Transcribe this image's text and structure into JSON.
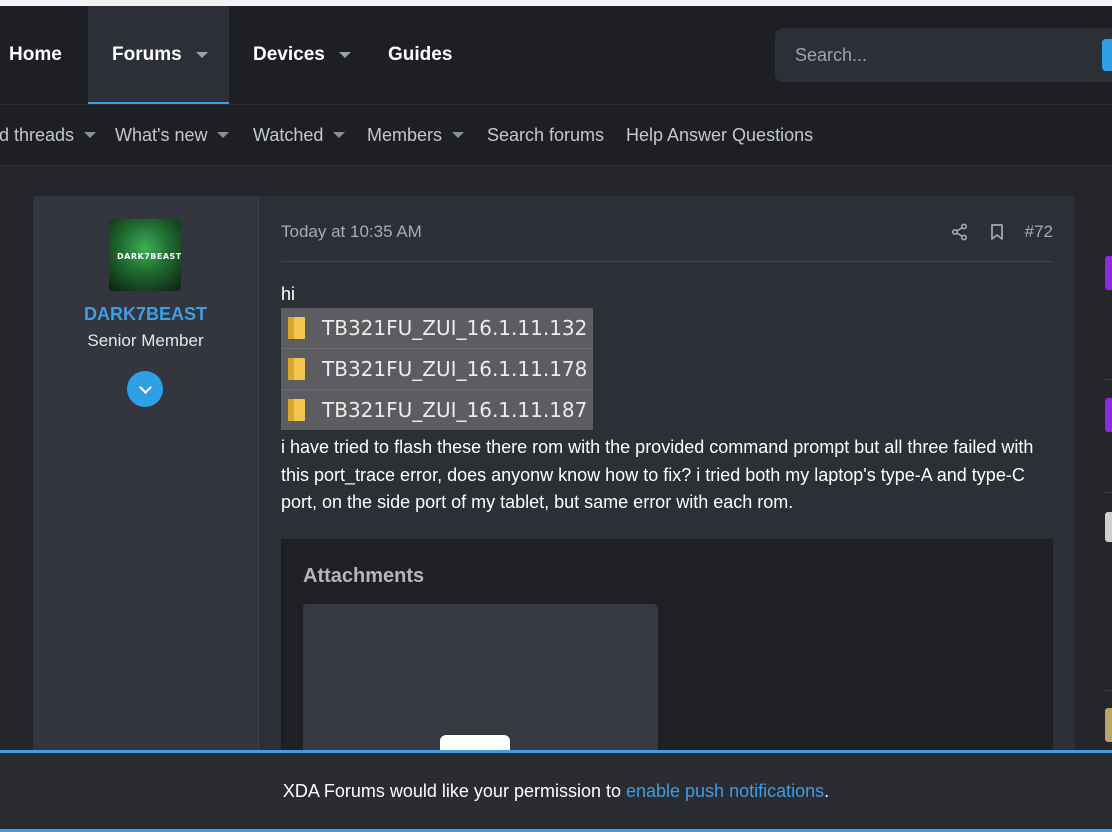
{
  "nav": {
    "tabs": [
      {
        "label": "Home",
        "has_menu": false
      },
      {
        "label": "Forums",
        "has_menu": true,
        "active": true
      },
      {
        "label": "Devices",
        "has_menu": true
      },
      {
        "label": "Guides",
        "has_menu": false
      }
    ],
    "search_placeholder": "Search..."
  },
  "subnav": {
    "items": [
      {
        "label": "d threads",
        "has_menu": true
      },
      {
        "label": "What's new",
        "has_menu": true
      },
      {
        "label": "Watched",
        "has_menu": true
      },
      {
        "label": "Members",
        "has_menu": true
      },
      {
        "label": "Search forums",
        "has_menu": false
      },
      {
        "label": "Help Answer Questions",
        "has_menu": false
      }
    ]
  },
  "post": {
    "user": {
      "avatar_text": "DARK7BEAST",
      "name": "DARK7BEAST",
      "title": "Senior Member"
    },
    "date": "Today at 10:35 AM",
    "post_number": "#72",
    "greeting": "hi",
    "folders": [
      "TB321FU_ZUI_16.1.11.132",
      "TB321FU_ZUI_16.1.11.178",
      "TB321FU_ZUI_16.1.11.187"
    ],
    "body": "i have tried to flash these there rom with the provided command prompt but all three failed with this port_trace error, does anyonw know how to fix? i tried both my laptop's type-A and type-C port, on the side port of my tablet, but same error with each rom.",
    "attachments_title": "Attachments"
  },
  "banner": {
    "prefix": "XDA Forums would like your permission to ",
    "link": "enable push notifications",
    "suffix": "."
  },
  "colors": {
    "accent": "#3c9ee3",
    "background": "#23252b",
    "navbar": "#1d1f25"
  }
}
